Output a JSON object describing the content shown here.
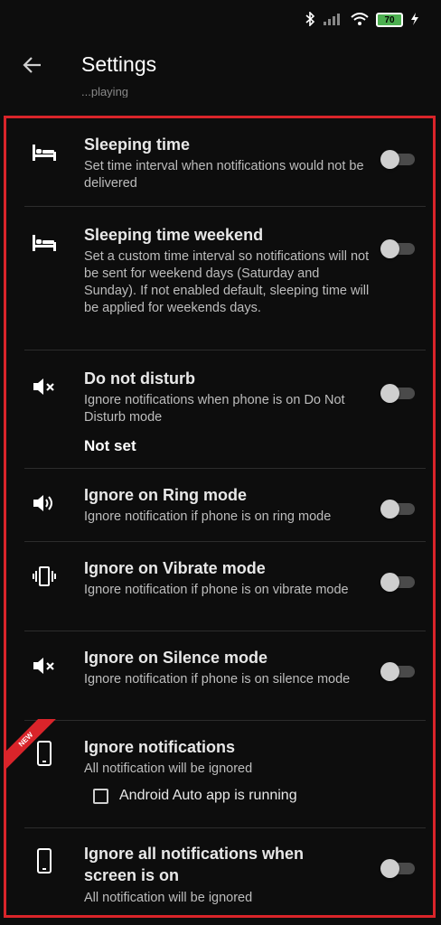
{
  "status_bar": {
    "icons": [
      "bluetooth-icon",
      "signal-icon",
      "wifi-icon"
    ],
    "battery_level": "70",
    "charging_icon": "bolt-icon"
  },
  "app_bar": {
    "title": "Settings",
    "back_icon": "arrow-left-icon"
  },
  "peek_text": "...playing",
  "accent_color": "#d9242a",
  "settings": [
    {
      "icon": "bed-icon",
      "title": "Sleeping time",
      "description": "Set time interval when notifications would not be delivered",
      "toggle": false
    },
    {
      "icon": "bed-icon",
      "title": "Sleeping time weekend",
      "description": "Set a custom time interval so notifications will not be sent for weekend days (Saturday and Sunday). If not enabled default, sleeping time will be applied for weekends days.",
      "toggle": false
    },
    {
      "icon": "volume-off-icon",
      "title": "Do not disturb",
      "description": "Ignore notifications when phone is on Do Not Disturb mode",
      "value": "Not set",
      "toggle": false
    },
    {
      "icon": "volume-up-icon",
      "title": "Ignore on Ring mode",
      "description": "Ignore notification if phone is on ring mode",
      "toggle": false
    },
    {
      "icon": "vibrate-icon",
      "title": "Ignore on Vibrate mode",
      "description": "Ignore notification if phone is on vibrate mode",
      "toggle": false
    },
    {
      "icon": "volume-off-icon",
      "title": "Ignore on Silence mode",
      "description": "Ignore notification if phone is on silence mode",
      "toggle": false
    },
    {
      "icon": "smartphone-icon",
      "title": "Ignore notifications",
      "description": "All notification will be ignored",
      "badge": "NEW",
      "checkbox_label": "Android Auto app is running",
      "checkbox_checked": false
    },
    {
      "icon": "smartphone-icon",
      "title": "Ignore all notifications when screen is on",
      "description": "All notification will be ignored",
      "toggle": false
    }
  ]
}
